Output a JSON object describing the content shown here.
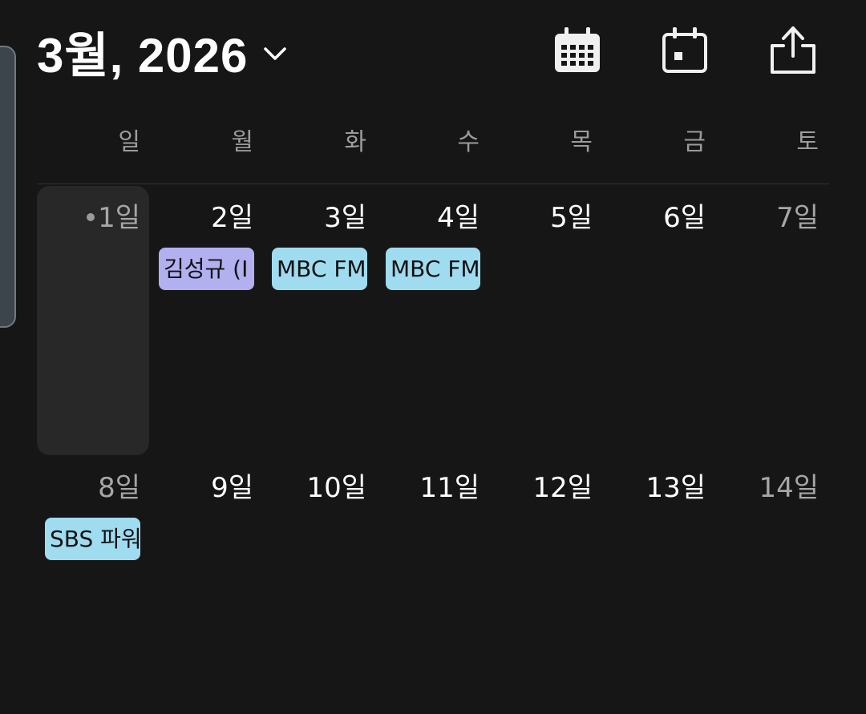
{
  "header": {
    "month_title": "3월, 2026",
    "icons": [
      "calendar-grid-icon",
      "calendar-today-icon",
      "share-icon"
    ]
  },
  "weekdays": [
    "일",
    "월",
    "화",
    "수",
    "목",
    "금",
    "토"
  ],
  "weeks": [
    {
      "days": [
        "1일",
        "2일",
        "3일",
        "4일",
        "5일",
        "6일",
        "7일"
      ]
    },
    {
      "days": [
        "8일",
        "9일",
        "10일",
        "11일",
        "12일",
        "13일",
        "14일"
      ]
    }
  ],
  "events": {
    "e1": "김성규 (I",
    "e2": "MBC FM",
    "e3": "MBC FM",
    "e4": "SBS 파워"
  },
  "colors": {
    "background": "#161616",
    "today_highlight": "#282828",
    "event_purple": "#b3b0f0",
    "event_cyan": "#9fdcf0"
  }
}
